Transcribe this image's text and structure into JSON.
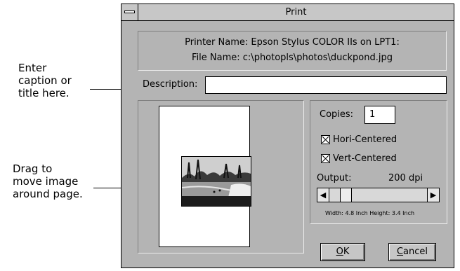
{
  "annotations": {
    "caption_hint": [
      "Enter",
      "caption or",
      "title here."
    ],
    "drag_hint": [
      "Drag to",
      "move image",
      "around page."
    ]
  },
  "dialog": {
    "title": "Print",
    "printer_name": "Printer Name: Epson Stylus COLOR IIs on LPT1:",
    "file_name": "File Name: c:\\photopls\\photos\\duckpond.jpg",
    "description_label": "Description:",
    "description_value": "",
    "copies_label": "Copies:",
    "copies_value": "1",
    "hori_centered_label": "Hori-Centered",
    "hori_centered_checked": true,
    "vert_centered_label": "Vert-Centered",
    "vert_centered_checked": true,
    "output_label": "Output:",
    "output_value": "200 dpi",
    "output_slider_position": 0.12,
    "size_text": "Width: 4.8 Inch  Height: 3.4 Inch",
    "ok_label_first": "O",
    "ok_label_rest": "K",
    "cancel_label_first": "C",
    "cancel_label_rest": "ancel"
  },
  "icons": {
    "system_menu": "system-menu-icon",
    "scroll_left": "left-arrow-icon",
    "scroll_right": "right-arrow-icon",
    "checkbox_mark": "x-mark-icon"
  }
}
